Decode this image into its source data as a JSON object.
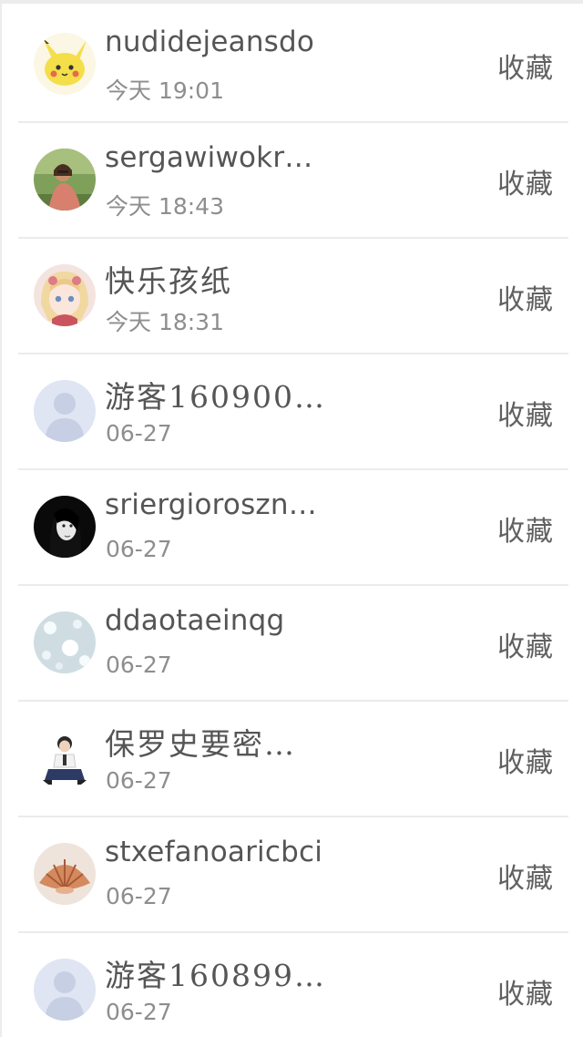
{
  "list": {
    "items": [
      {
        "name": "nudidejeansdo",
        "time": "今天 19:01",
        "action": "收藏",
        "avatar": "pikachu-avatar"
      },
      {
        "name": "sergawiwokr…",
        "time": "今天 18:43",
        "action": "收藏",
        "avatar": "photo-avatar"
      },
      {
        "name": "快乐孩纸",
        "time": "今天 18:31",
        "action": "收藏",
        "avatar": "anime-avatar"
      },
      {
        "name": "游客160900…",
        "time": "06-27",
        "action": "收藏",
        "avatar": "default-avatar"
      },
      {
        "name": "sriergioroszn…",
        "time": "06-27",
        "action": "收藏",
        "avatar": "portrait-avatar"
      },
      {
        "name": "ddaotaeinqg",
        "time": "06-27",
        "action": "收藏",
        "avatar": "snowflake-avatar"
      },
      {
        "name": "保罗史要密…",
        "time": "06-27",
        "action": "收藏",
        "avatar": "boy-avatar"
      },
      {
        "name": "stxefanoaricbci",
        "time": "06-27",
        "action": "收藏",
        "avatar": "shell-avatar"
      },
      {
        "name": "游客160899…",
        "time": "06-27",
        "action": "收藏",
        "avatar": "default-avatar"
      }
    ]
  }
}
